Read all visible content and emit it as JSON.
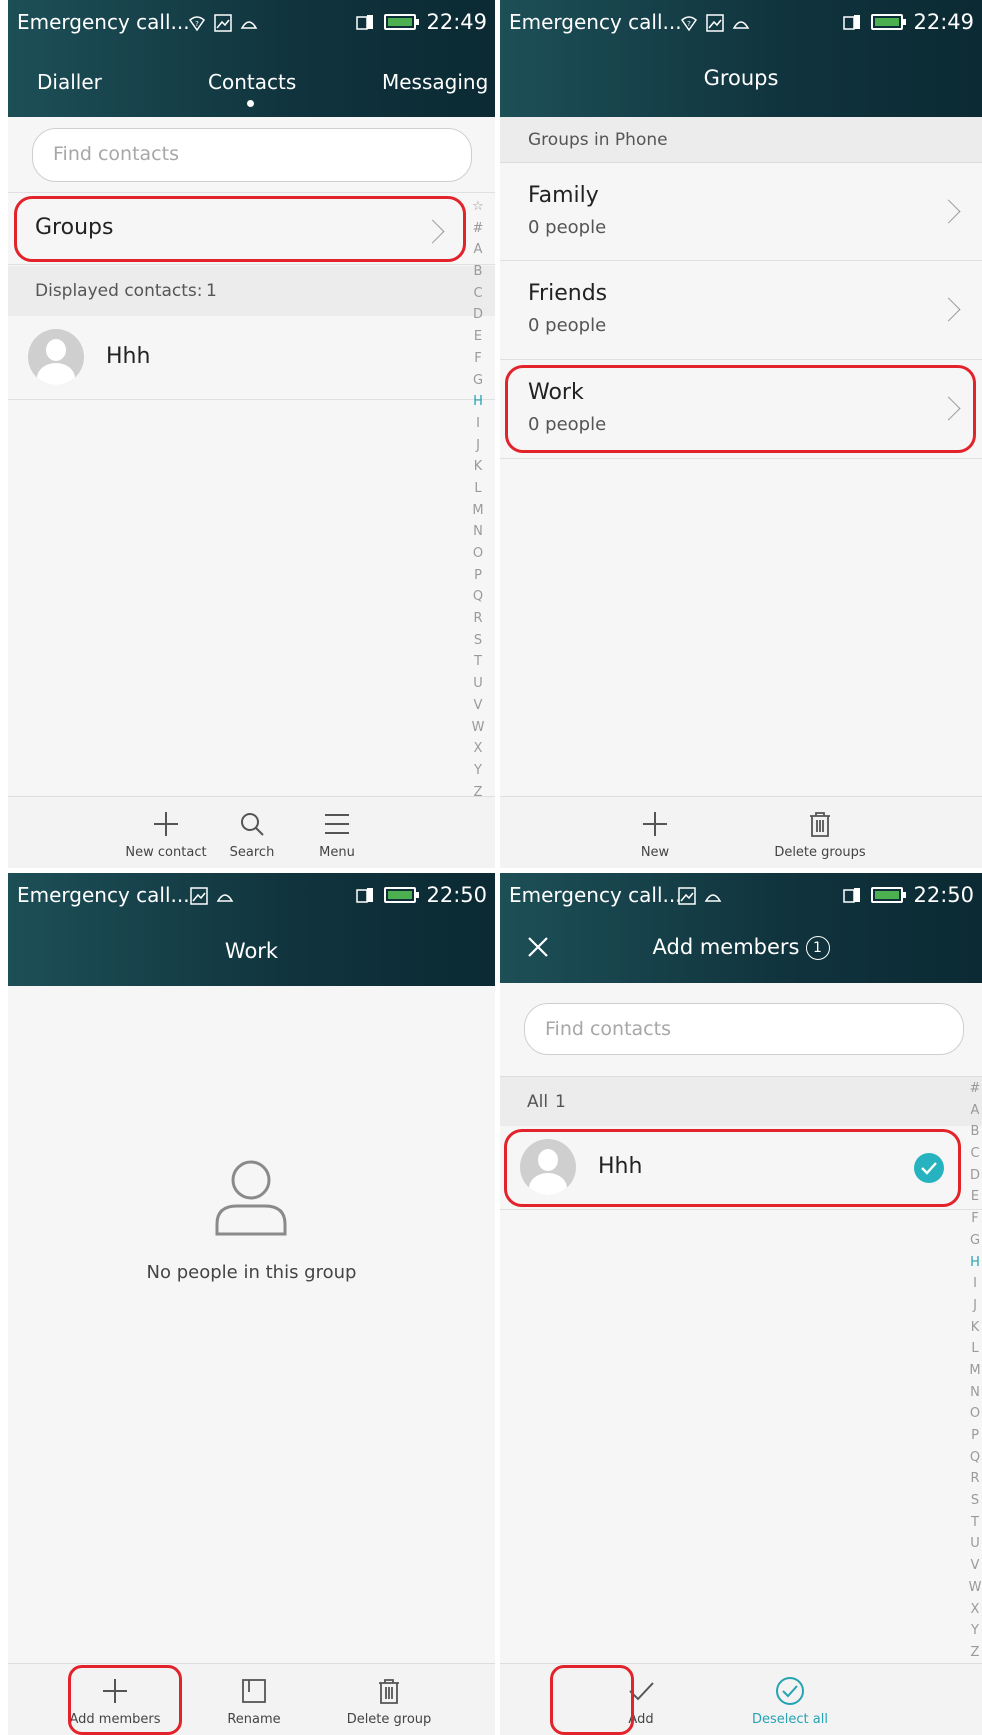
{
  "status": {
    "carrier": "Emergency call...",
    "time_1": "22:49",
    "time_2": "22:49",
    "time_3": "22:50",
    "time_4": "22:50"
  },
  "contacts_screen": {
    "tabs": [
      "Dialler",
      "Contacts",
      "Messaging"
    ],
    "search_placeholder": "Find contacts",
    "groups_label": "Groups",
    "displayed_label": "Displayed contacts:",
    "displayed_count": "1",
    "contact_name": "Hhh",
    "index_letters": [
      "☆",
      "#",
      "A",
      "B",
      "C",
      "D",
      "E",
      "F",
      "G",
      "H",
      "I",
      "J",
      "K",
      "L",
      "M",
      "N",
      "O",
      "P",
      "Q",
      "R",
      "S",
      "T",
      "U",
      "V",
      "W",
      "X",
      "Y",
      "Z"
    ],
    "toolbar": {
      "new_contact": "New contact",
      "search": "Search",
      "menu": "Menu"
    }
  },
  "groups_screen": {
    "title": "Groups",
    "section": "Groups in Phone",
    "groups": [
      {
        "name": "Family",
        "count": "0 people"
      },
      {
        "name": "Friends",
        "count": "0 people"
      },
      {
        "name": "Work",
        "count": "0 people"
      }
    ],
    "toolbar": {
      "new": "New",
      "delete": "Delete groups"
    }
  },
  "work_screen": {
    "title": "Work",
    "empty_message": "No people in this group",
    "toolbar": {
      "add_members": "Add members",
      "rename": "Rename",
      "delete_group": "Delete group"
    }
  },
  "add_members_screen": {
    "title": "Add members",
    "badge": "1",
    "search_placeholder": "Find contacts",
    "section_label": "All",
    "section_count": "1",
    "contact_name": "Hhh",
    "index_letters": [
      "#",
      "A",
      "B",
      "C",
      "D",
      "E",
      "F",
      "G",
      "H",
      "I",
      "J",
      "K",
      "L",
      "M",
      "N",
      "O",
      "P",
      "Q",
      "R",
      "S",
      "T",
      "U",
      "V",
      "W",
      "X",
      "Y",
      "Z"
    ],
    "toolbar": {
      "add": "Add",
      "deselect_all": "Deselect all"
    }
  },
  "colors": {
    "accent": "#26a3b3",
    "highlight": "#e3232b",
    "header": "#10333d"
  }
}
